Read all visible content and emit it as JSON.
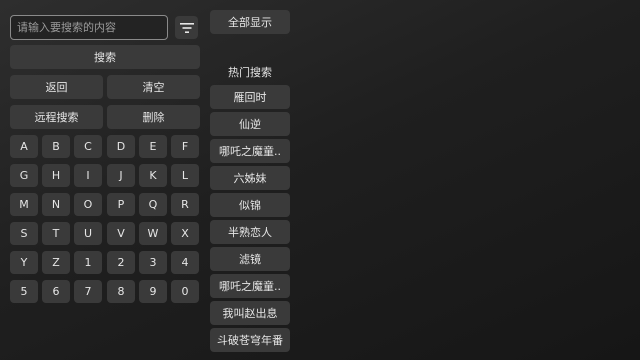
{
  "search": {
    "placeholder": "请输入要搜索的内容",
    "value": ""
  },
  "icons": {
    "filter": "filter-icon"
  },
  "buttons": {
    "search": "搜索",
    "back": "返回",
    "clear": "清空",
    "remote_search": "远程搜索",
    "delete": "删除",
    "show_all": "全部显示"
  },
  "keyboard": {
    "rows": [
      [
        "A",
        "B",
        "C",
        "D",
        "E",
        "F"
      ],
      [
        "G",
        "H",
        "I",
        "J",
        "K",
        "L"
      ],
      [
        "M",
        "N",
        "O",
        "P",
        "Q",
        "R"
      ],
      [
        "S",
        "T",
        "U",
        "V",
        "W",
        "X"
      ],
      [
        "Y",
        "Z",
        "1",
        "2",
        "3",
        "4"
      ],
      [
        "5",
        "6",
        "7",
        "8",
        "9",
        "0"
      ]
    ]
  },
  "hot_search": {
    "title": "热门搜索",
    "items": [
      "雁回时",
      "仙逆",
      "哪吒之魔童..",
      "六姊妹",
      "似锦",
      "半熟恋人",
      "滤镜",
      "哪吒之魔童..",
      "我叫赵出息",
      "斗破苍穹年番"
    ]
  }
}
